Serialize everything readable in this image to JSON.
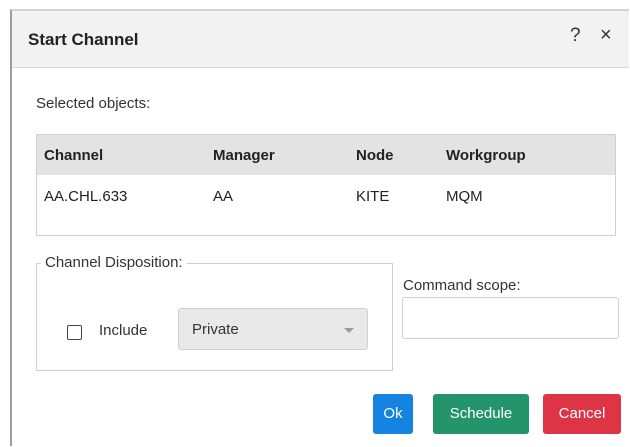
{
  "dialog": {
    "title": "Start Channel",
    "help_glyph": "?",
    "close_glyph": "×"
  },
  "selected_objects": {
    "label": "Selected objects:",
    "columns": [
      "Channel",
      "Manager",
      "Node",
      "Workgroup"
    ],
    "rows": [
      [
        "AA.CHL.633",
        "AA",
        "KITE",
        "MQM"
      ]
    ]
  },
  "disposition": {
    "legend": "Channel Disposition:",
    "include_label": "Include",
    "include_checked": false,
    "select_value": "Private"
  },
  "command_scope": {
    "label": "Command scope:",
    "value": ""
  },
  "buttons": {
    "ok": "Ok",
    "schedule": "Schedule",
    "cancel": "Cancel"
  },
  "colors": {
    "ok": "#1584e0",
    "schedule": "#24956b",
    "cancel": "#dd3545"
  }
}
